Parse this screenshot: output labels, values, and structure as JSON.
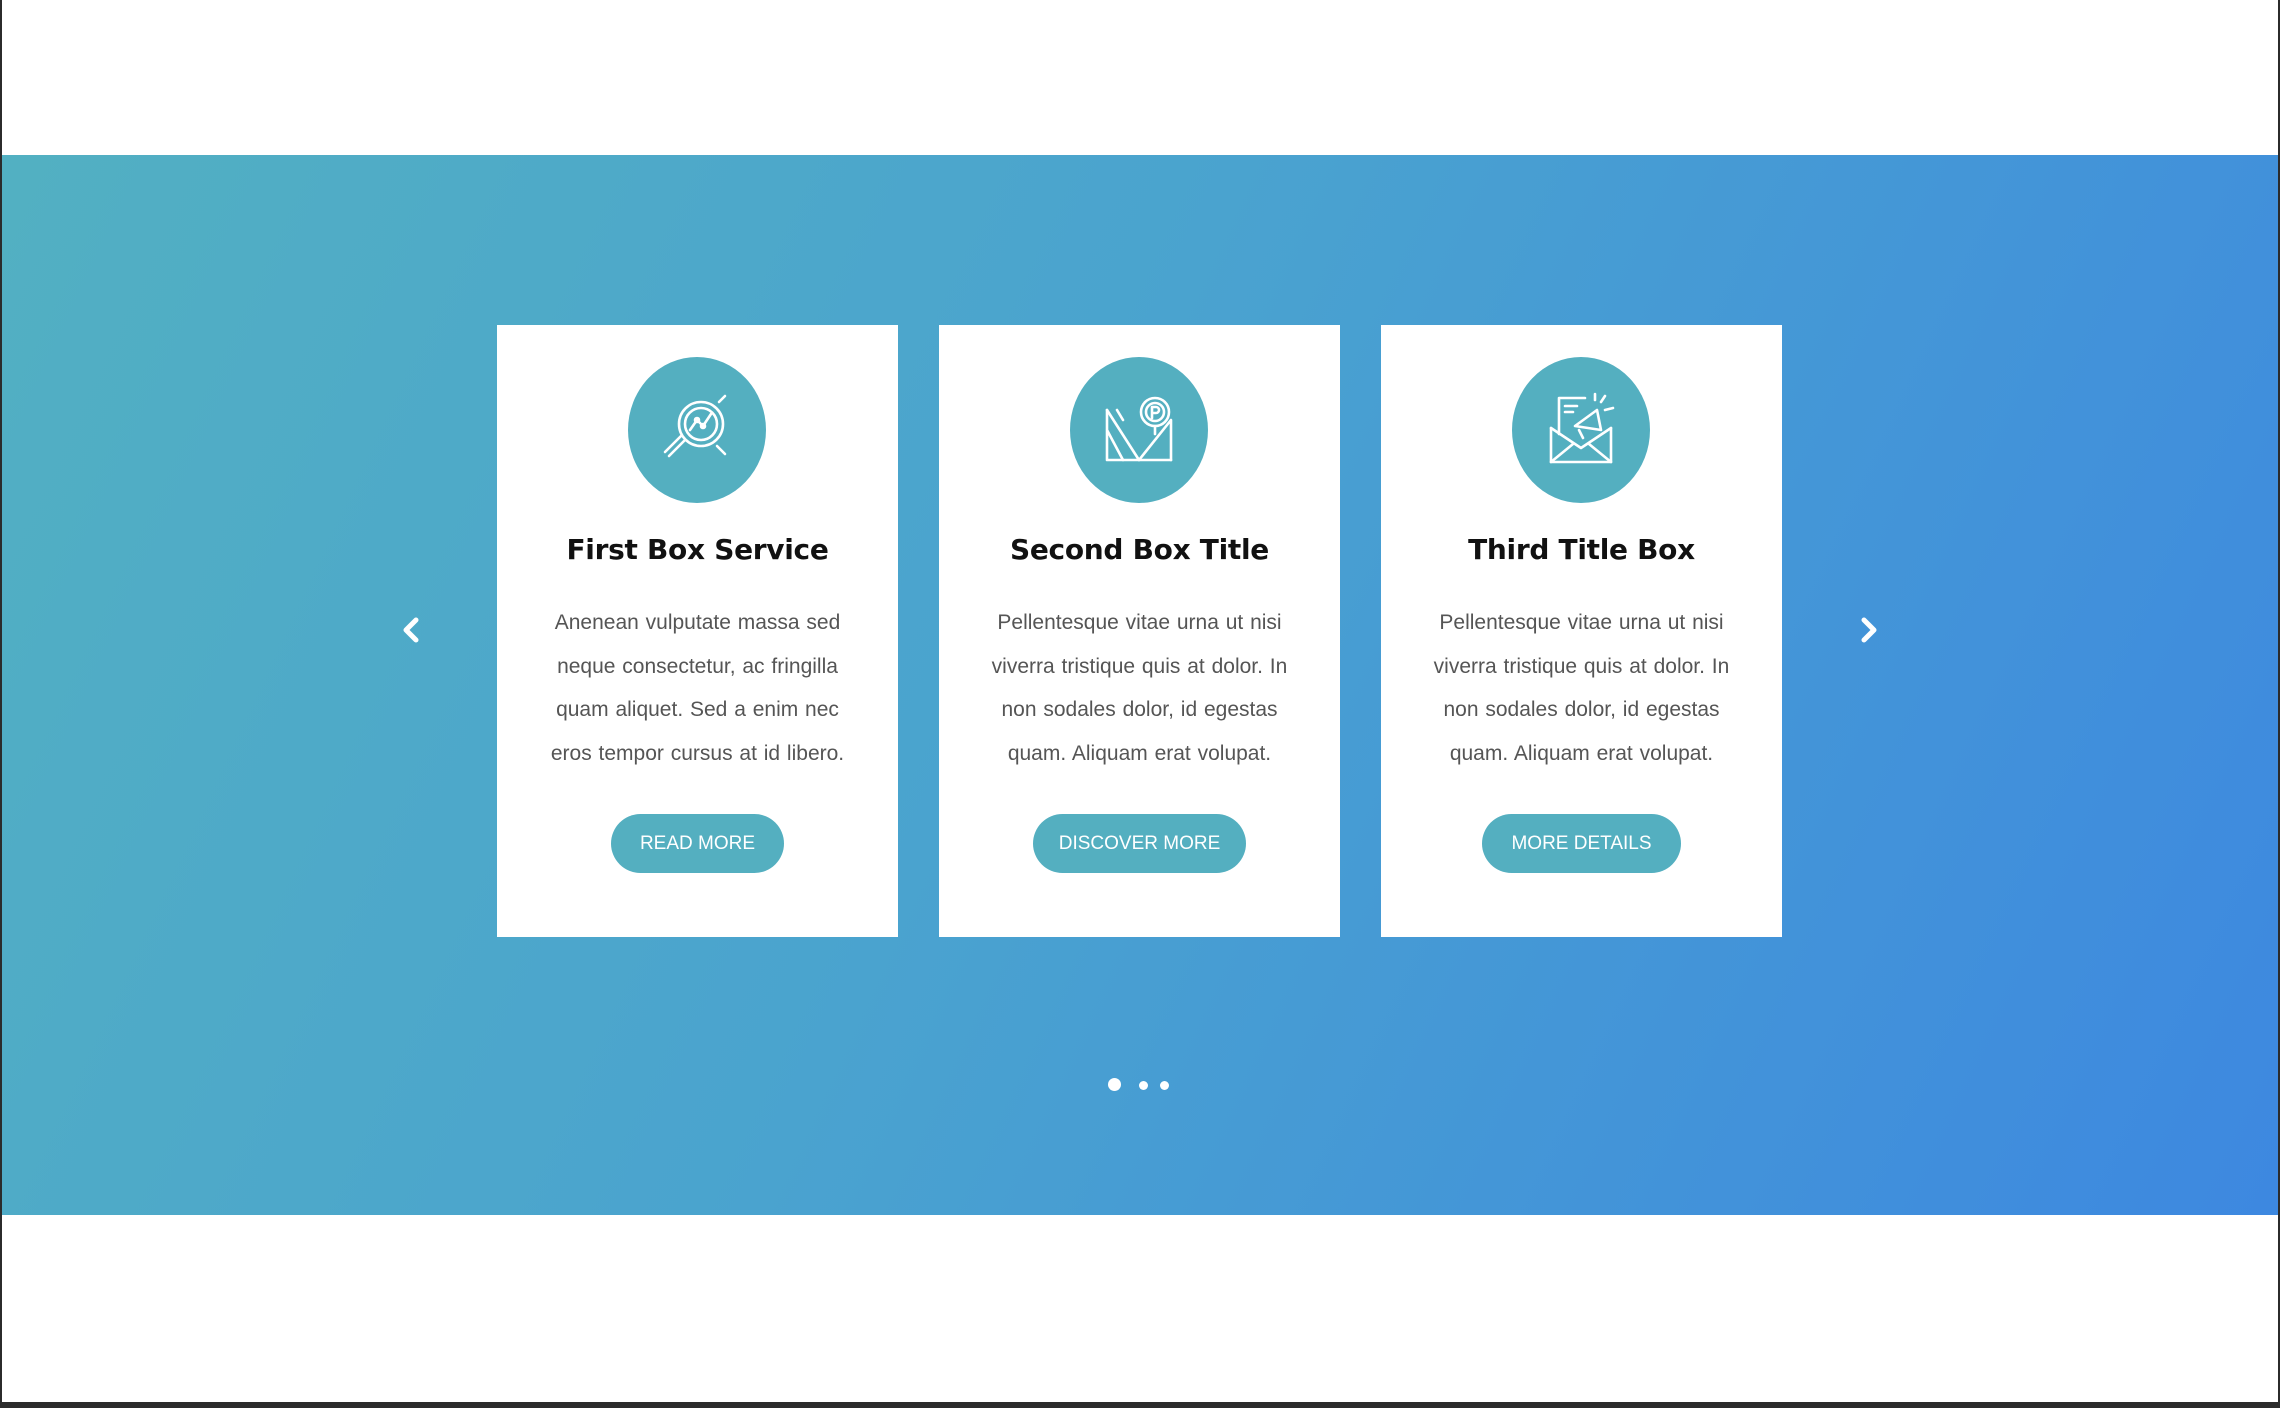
{
  "slider": {
    "prev_icon": "chevron-left-icon",
    "next_icon": "chevron-right-icon",
    "cards": [
      {
        "icon": "search-chart-icon",
        "title": "First Box Service",
        "text": "Anenean vulputate massa sed neque consectetur, ac fringilla quam aliquet. Sed a enim nec eros tempor cursus at id libero.",
        "button": "READ MORE"
      },
      {
        "icon": "map-pin-icon",
        "title": "Second Box Title",
        "text": "Pellentesque vitae urna ut nisi viverra tristique quis at dolor. In non sodales dolor, id egestas quam. Aliquam erat volupat.",
        "button": "DISCOVER MORE"
      },
      {
        "icon": "email-megaphone-icon",
        "title": "Third Title Box",
        "text": "Pellentesque vitae urna ut nisi viverra tristique quis at dolor. In non sodales dolor, id egestas quam. Aliquam erat volupat.",
        "button": "MORE DETAILS"
      }
    ],
    "pagination": {
      "total": 3,
      "active": 1
    }
  },
  "colors": {
    "accent": "#54afc0",
    "gradient_start": "#52b0c2",
    "gradient_end": "#3d88e0"
  }
}
